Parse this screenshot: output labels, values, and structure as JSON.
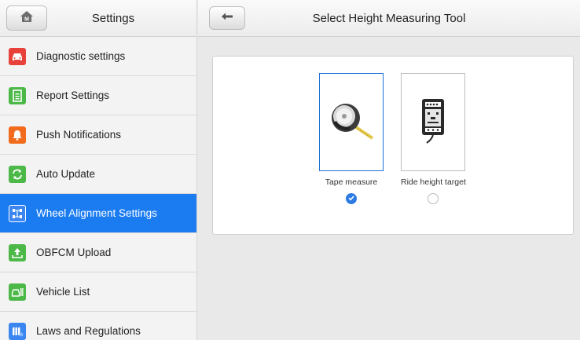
{
  "left_header": {
    "title": "Settings",
    "home_icon": "home-icon"
  },
  "sidebar": {
    "items": [
      {
        "label": "Diagnostic settings",
        "icon": "car-icon",
        "color": "#e8413a",
        "active": false
      },
      {
        "label": "Report Settings",
        "icon": "document-icon",
        "color": "#4cb847",
        "active": false
      },
      {
        "label": "Push Notifications",
        "icon": "bell-icon",
        "color": "#f26b1d",
        "active": false
      },
      {
        "label": "Auto Update",
        "icon": "refresh-icon",
        "color": "#4cb847",
        "active": false
      },
      {
        "label": "Wheel Alignment Settings",
        "icon": "wheel-alignment-icon",
        "color": "#3b86f0",
        "active": true
      },
      {
        "label": "OBFCM Upload",
        "icon": "upload-icon",
        "color": "#4cb847",
        "active": false
      },
      {
        "label": "Vehicle List",
        "icon": "vehicle-list-icon",
        "color": "#4cb847",
        "active": false
      },
      {
        "label": "Laws and Regulations",
        "icon": "books-icon",
        "color": "#3b86f0",
        "active": false
      }
    ]
  },
  "right_header": {
    "title": "Select Height Measuring Tool",
    "back_icon": "back-arrow-icon"
  },
  "tools": {
    "items": [
      {
        "label": "Tape measure",
        "icon": "tape-measure-icon",
        "selected": true
      },
      {
        "label": "Ride height target",
        "icon": "ride-height-target-icon",
        "selected": false
      }
    ]
  },
  "colors": {
    "accent": "#1b7cf2",
    "radio_selected": "#2c7be5"
  }
}
